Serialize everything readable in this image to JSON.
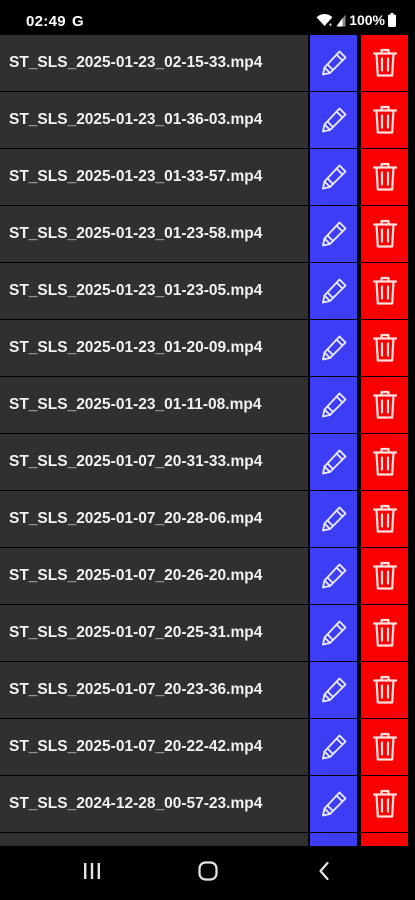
{
  "status_bar": {
    "time": "02:49",
    "google_indicator": "G",
    "battery_percent": "100%",
    "icons": [
      "wifi-icon",
      "signal-icon",
      "battery-icon"
    ]
  },
  "files": [
    {
      "name": "ST_SLS_2025-01-23_02-15-33.mp4"
    },
    {
      "name": "ST_SLS_2025-01-23_01-36-03.mp4"
    },
    {
      "name": "ST_SLS_2025-01-23_01-33-57.mp4"
    },
    {
      "name": "ST_SLS_2025-01-23_01-23-58.mp4"
    },
    {
      "name": "ST_SLS_2025-01-23_01-23-05.mp4"
    },
    {
      "name": "ST_SLS_2025-01-23_01-20-09.mp4"
    },
    {
      "name": "ST_SLS_2025-01-23_01-11-08.mp4"
    },
    {
      "name": "ST_SLS_2025-01-07_20-31-33.mp4"
    },
    {
      "name": "ST_SLS_2025-01-07_20-28-06.mp4"
    },
    {
      "name": "ST_SLS_2025-01-07_20-26-20.mp4"
    },
    {
      "name": "ST_SLS_2025-01-07_20-25-31.mp4"
    },
    {
      "name": "ST_SLS_2025-01-07_20-23-36.mp4"
    },
    {
      "name": "ST_SLS_2025-01-07_20-22-42.mp4"
    },
    {
      "name": "ST_SLS_2024-12-28_00-57-23.mp4"
    },
    {
      "name": ""
    }
  ],
  "row_actions": {
    "edit_icon": "pencil-icon",
    "delete_icon": "trash-icon"
  },
  "colors": {
    "row_background": "#303030",
    "edit_button": "#3d3df5",
    "delete_button": "#fb0000",
    "edit_icon": "#e8e8ff",
    "delete_icon": "#ffe0e0"
  },
  "nav_bar": {
    "buttons": [
      "recents-icon",
      "home-icon",
      "back-icon"
    ]
  }
}
